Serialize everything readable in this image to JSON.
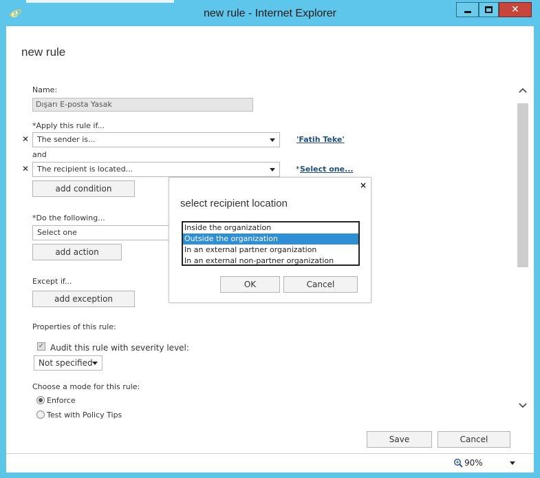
{
  "window": {
    "title": "new rule - Internet Explorer",
    "controls": {
      "minimize": "minimize",
      "maximize": "maximize",
      "close": "✕"
    }
  },
  "page": {
    "title": "new rule"
  },
  "form": {
    "name_label": "Name:",
    "name_value": "Dışarı E-posta Yasak",
    "apply_label": "*Apply this rule if...",
    "condition1": {
      "value": "The sender is...",
      "link": "'Fatih Teke'"
    },
    "and_label": "and",
    "condition2": {
      "value": "The recipient is located...",
      "link_prefix": "*",
      "link": "Select one..."
    },
    "add_condition": "add condition",
    "do_label": "*Do the following...",
    "action_select": "Select one",
    "add_action": "add action",
    "except_label": "Except if...",
    "add_exception": "add exception",
    "properties_label": "Properties of this rule:",
    "audit_label": "Audit this rule with severity level:",
    "audit_checked": true,
    "severity_select": "Not specified",
    "mode_label": "Choose a mode for this rule:",
    "mode_options": [
      {
        "label": "Enforce",
        "selected": true
      },
      {
        "label": "Test with Policy Tips",
        "selected": false
      }
    ]
  },
  "footer": {
    "save": "Save",
    "cancel": "Cancel",
    "zoom": "90%"
  },
  "dialog": {
    "close": "×",
    "title": "select recipient location",
    "options": [
      {
        "label": "Inside the organization",
        "selected": false
      },
      {
        "label": "Outside the organization",
        "selected": true
      },
      {
        "label": "In an external partner organization",
        "selected": false
      },
      {
        "label": "In an external non-partner organization",
        "selected": false
      }
    ],
    "ok": "OK",
    "cancel": "Cancel"
  },
  "icons": {
    "browser": "internet-explorer-icon",
    "remove": "x-icon",
    "zoom": "magnifier-icon",
    "scroll_up": "chevron-up-icon",
    "scroll_down": "chevron-down-icon"
  },
  "colors": {
    "titlebar": "#5ec6ea",
    "close_button": "#c8453b",
    "selection": "#2f8fd6",
    "link": "#1f4e79"
  }
}
